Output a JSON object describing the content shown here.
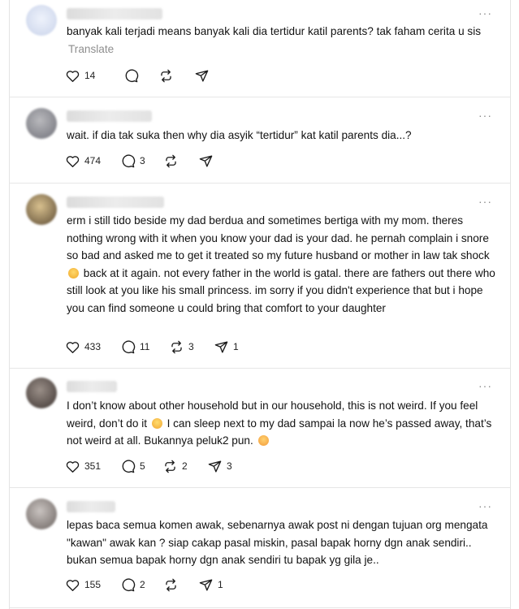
{
  "posts": [
    {
      "text": "banyak kali terjadi means banyak kali dia tertidur katil parents? tak faham cerita u sis",
      "translate_label": "Translate",
      "more_label": "···",
      "likes": "14",
      "replies": "",
      "reposts": "",
      "shares": ""
    },
    {
      "text": "wait. if dia tak suka then why dia asyik “tertidur” kat katil parents dia...?",
      "more_label": "···",
      "likes": "474",
      "replies": "3",
      "reposts": "",
      "shares": ""
    },
    {
      "text_before": "erm i still tido beside my dad berdua and sometimes bertiga with my mom. theres nothing wrong with it when you know your dad is your dad. he pernah complain i snore so bad and asked me to get it treated so my future husband or mother in law tak shock",
      "text_after": "back at it again. not every father in the world is gatal. there are fathers out there who still look at you like his small princess. im sorry if you didn't experience that but i hope you can find someone u could bring that comfort to your daughter",
      "emoji": "laughing-emoji",
      "more_label": "···",
      "likes": "433",
      "replies": "11",
      "reposts": "3",
      "shares": "1"
    },
    {
      "text_before": "I don’t know about other household but in our household, this is not weird. If you feel weird, don’t do it",
      "text_middle": "I can sleep next to my dad sampai la now he’s passed away, that’s not weird at all. Bukannya peluk2 pun.",
      "emoji1": "sweat-smile-emoji",
      "emoji2": "relieved-emoji",
      "more_label": "···",
      "likes": "351",
      "replies": "5",
      "reposts": "2",
      "shares": "3"
    },
    {
      "text": "lepas baca semua komen awak, sebenarnya awak post ni dengan tujuan org mengata \"kawan\" awak kan ? siap cakap pasal miskin, pasal bapak horny dgn anak sendiri.. bukan semua bapak horny dgn anak sendiri tu bapak yg gila je..",
      "more_label": "···",
      "likes": "155",
      "replies": "2",
      "reposts": "",
      "shares": "1"
    }
  ],
  "colors": {
    "text": "#121212",
    "muted": "#8e8e8e",
    "divider": "#e6e6e6",
    "icon": "#1a1a1a"
  }
}
